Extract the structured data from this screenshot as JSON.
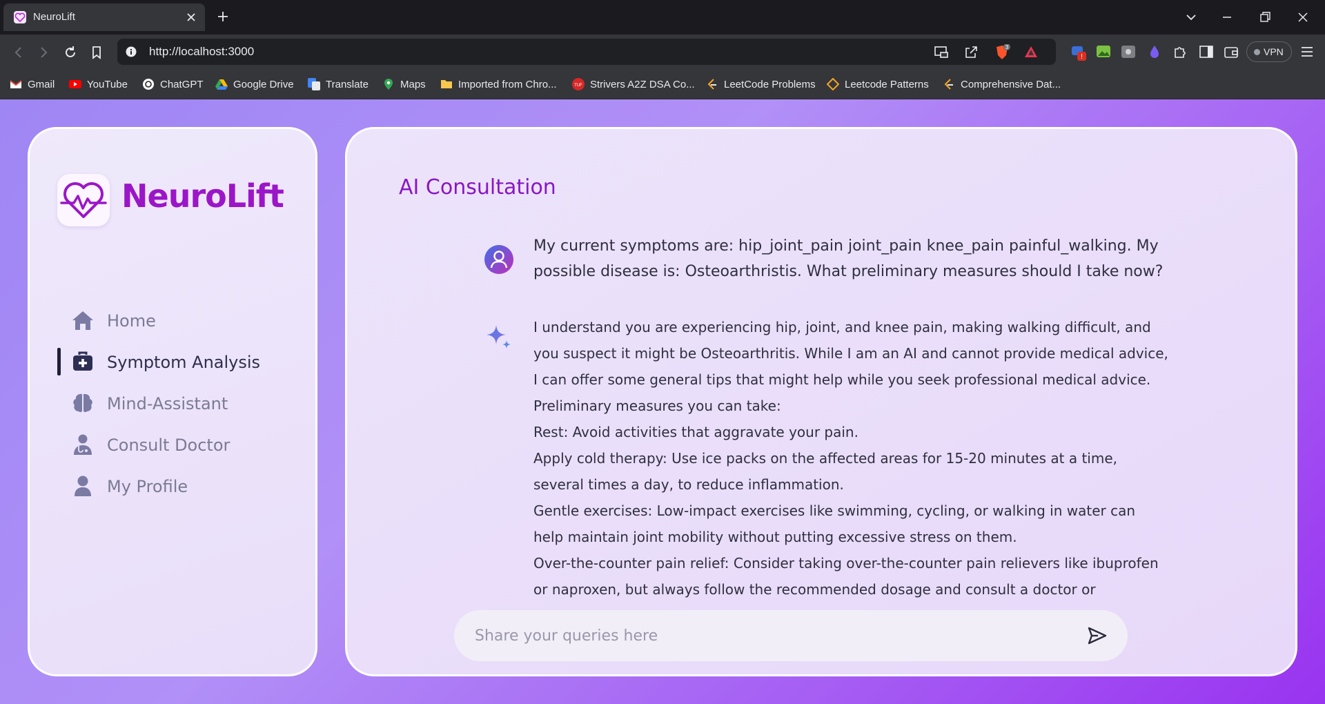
{
  "browser": {
    "tab_title": "NeuroLift",
    "url": "http://localhost:3000",
    "brave_badge": "3",
    "vpn_label": "VPN",
    "bookmarks": [
      {
        "label": "Gmail",
        "color": "#ea4335"
      },
      {
        "label": "YouTube",
        "color": "#ff0000"
      },
      {
        "label": "ChatGPT",
        "color": "#ffffff"
      },
      {
        "label": "Google Drive",
        "color": "#fbbc04"
      },
      {
        "label": "Translate",
        "color": "#4285f4"
      },
      {
        "label": "Maps",
        "color": "#34a853"
      },
      {
        "label": "Imported from Chro...",
        "color": "#f9c74f"
      },
      {
        "label": "Strivers A2Z DSA Co...",
        "color": "#d62828"
      },
      {
        "label": "LeetCode Problems",
        "color": "#f5a623"
      },
      {
        "label": "Leetcode Patterns",
        "color": "#f5a623"
      },
      {
        "label": "Comprehensive Dat...",
        "color": "#f5a623"
      }
    ]
  },
  "app": {
    "brand": "NeuroLift",
    "brand_color": "#9b16c7",
    "nav": [
      {
        "label": "Home",
        "icon": "home-icon",
        "active": false
      },
      {
        "label": "Symptom Analysis",
        "icon": "medical-kit-icon",
        "active": true
      },
      {
        "label": "Mind-Assistant",
        "icon": "brain-icon",
        "active": false
      },
      {
        "label": "Consult Doctor",
        "icon": "doctor-icon",
        "active": false
      },
      {
        "label": "My Profile",
        "icon": "user-icon",
        "active": false
      }
    ]
  },
  "consultation": {
    "title": "AI Consultation",
    "user_message": "My current symptoms are: hip_joint_pain joint_pain knee_pain painful_walking. My possible disease is: Osteoarthristis. What preliminary measures should I take now?",
    "ai_paragraphs": [
      "I understand you are experiencing hip, joint, and knee pain, making walking difficult, and you suspect it might be Osteoarthritis. While I am an AI and cannot provide medical advice, I can offer some general tips that might help while you seek professional medical advice. Preliminary measures you can take:",
      "Rest: Avoid activities that aggravate your pain.",
      "Apply cold therapy: Use ice packs on the affected areas for 15-20 minutes at a time, several times a day, to reduce inflammation.",
      "Gentle exercises: Low-impact exercises like swimming, cycling, or walking in water can help maintain joint mobility without putting excessive stress on them.",
      "Over-the-counter pain relief: Consider taking over-the-counter pain relievers like ibuprofen or naproxen, but always follow the recommended dosage and consult a doctor or pharmacist if"
    ],
    "input_placeholder": "Share your queries here",
    "input_value": ""
  }
}
